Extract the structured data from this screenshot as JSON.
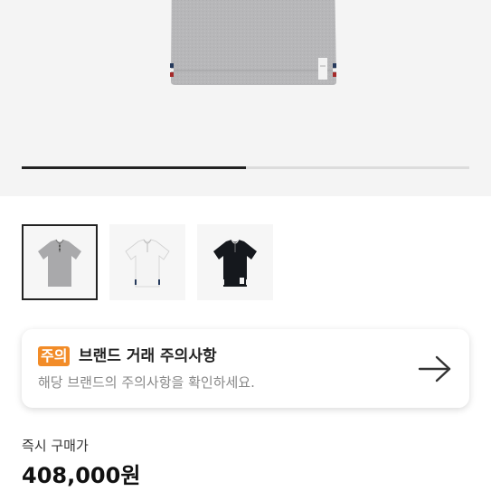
{
  "gallery": {
    "progress_fraction": 0.5,
    "thumbnails": [
      {
        "icon": "gray-polo-shirt-icon",
        "color": "#a9a9ab",
        "selected": true
      },
      {
        "icon": "white-polo-shirt-icon",
        "color": "#f4f4f4",
        "selected": false
      },
      {
        "icon": "black-polo-shirt-icon",
        "color": "#15181d",
        "selected": false
      }
    ]
  },
  "notice": {
    "badge": "주의",
    "badge_color": "#f28c28",
    "title": "브랜드 거래 주의사항",
    "subtitle": "해당 브랜드의 주의사항을 확인하세요.",
    "icon": "arrow-right-icon"
  },
  "price": {
    "label": "즉시 구매가",
    "value": "408,000원"
  }
}
